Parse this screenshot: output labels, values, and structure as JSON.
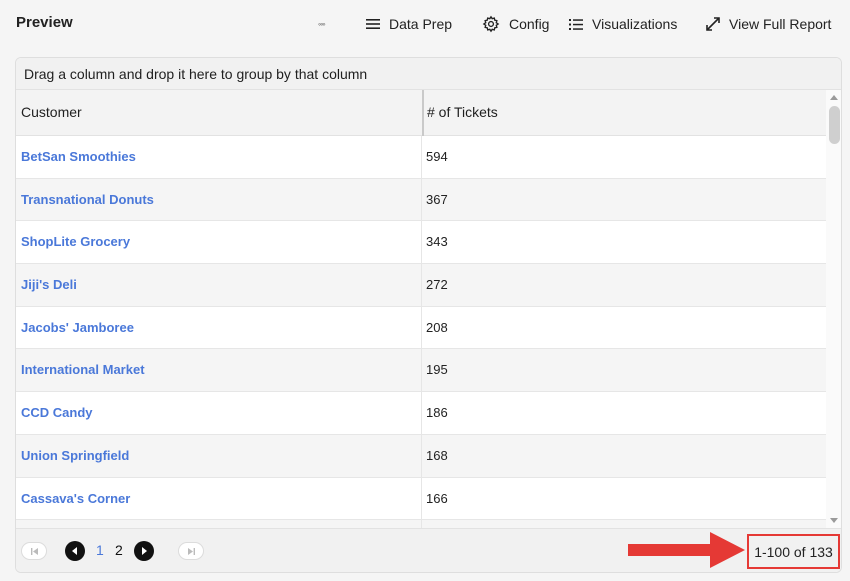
{
  "header": {
    "title": "Preview",
    "more_label": "◦◦◦",
    "data_prep_label": "Data Prep",
    "config_label": "Config",
    "visualizations_label": "Visualizations",
    "full_report_label": "View Full Report"
  },
  "grid": {
    "group_hint": "Drag a column and drop it here to group by that column",
    "columns": [
      "Customer",
      "# of Tickets"
    ],
    "rows": [
      {
        "customer": "BetSan Smoothies",
        "tickets": "594"
      },
      {
        "customer": "Transnational Donuts",
        "tickets": "367"
      },
      {
        "customer": "ShopLite Grocery",
        "tickets": "343"
      },
      {
        "customer": "Jiji's Deli",
        "tickets": "272"
      },
      {
        "customer": "Jacobs' Jamboree",
        "tickets": "208"
      },
      {
        "customer": "International Market",
        "tickets": "195"
      },
      {
        "customer": "CCD Candy",
        "tickets": "186"
      },
      {
        "customer": "Union Springfield",
        "tickets": "168"
      },
      {
        "customer": "Cassava's Corner",
        "tickets": "166"
      },
      {
        "customer": "",
        "tickets": ""
      }
    ]
  },
  "pager": {
    "pages": [
      "1",
      "2"
    ],
    "current_page": "1",
    "range_text": "1-100 of 133"
  },
  "colors": {
    "link": "#4a78d9",
    "highlight": "#e53935"
  }
}
